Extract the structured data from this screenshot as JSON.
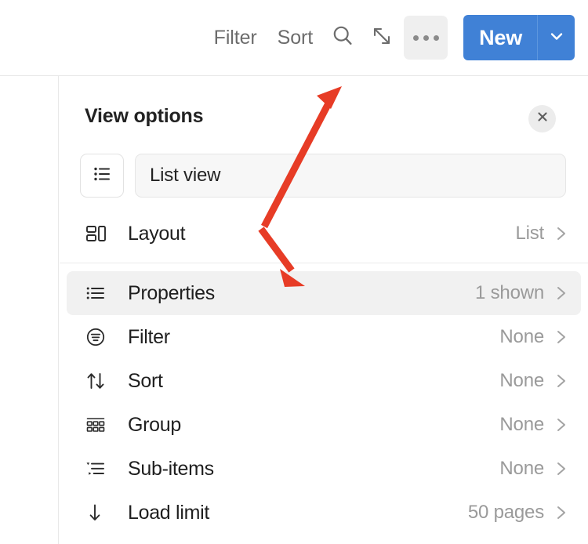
{
  "toolbar": {
    "filter_label": "Filter",
    "sort_label": "Sort",
    "search_icon": "search-icon",
    "expand_icon": "expand-diagonal-icon",
    "more_icon": "ellipsis-icon",
    "new_label": "New",
    "new_caret_icon": "chevron-down-icon",
    "new_button_color": "#4081d6"
  },
  "panel": {
    "title": "View options",
    "close_icon": "close-icon",
    "view_icon": "list-view-icon",
    "view_name_value": "List view",
    "view_name_placeholder": "View name",
    "rows": [
      {
        "icon": "layout-icon",
        "label": "Layout",
        "value": "List",
        "caret": "chevron-right-icon",
        "highlighted": false
      },
      {
        "icon": "properties-icon",
        "label": "Properties",
        "value": "1 shown",
        "caret": "chevron-right-icon",
        "highlighted": true
      },
      {
        "icon": "filter-icon",
        "label": "Filter",
        "value": "None",
        "caret": "chevron-right-icon",
        "highlighted": false
      },
      {
        "icon": "sort-icon",
        "label": "Sort",
        "value": "None",
        "caret": "chevron-right-icon",
        "highlighted": false
      },
      {
        "icon": "group-icon",
        "label": "Group",
        "value": "None",
        "caret": "chevron-right-icon",
        "highlighted": false
      },
      {
        "icon": "sub-items-icon",
        "label": "Sub-items",
        "value": "None",
        "caret": "chevron-right-icon",
        "highlighted": false
      },
      {
        "icon": "load-limit-icon",
        "label": "Load limit",
        "value": "50 pages",
        "caret": "chevron-right-icon",
        "highlighted": false
      }
    ]
  },
  "annotations": {
    "arrow_color": "#e73c26",
    "arrow_up_target": "ellipsis-button",
    "arrow_down_target": "properties-row"
  }
}
